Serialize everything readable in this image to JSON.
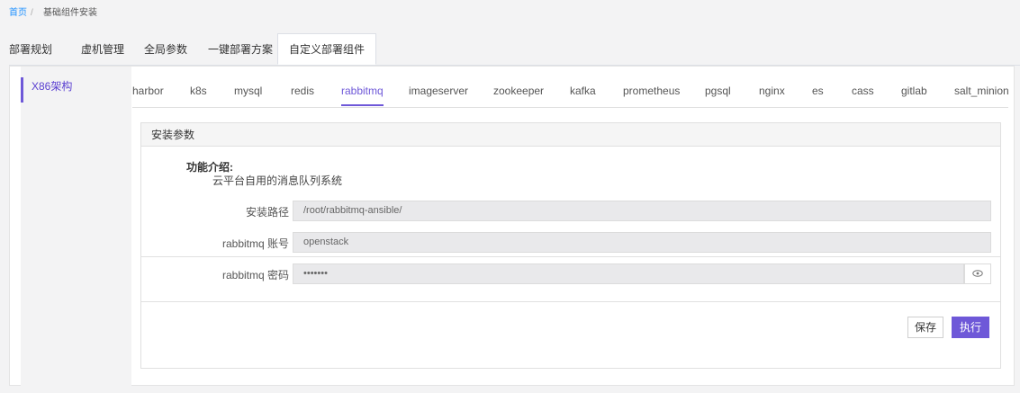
{
  "breadcrumb": {
    "home": "首页",
    "separator": "/",
    "current": "基础组件安装"
  },
  "top_tabs": [
    {
      "label": "部署规划"
    },
    {
      "label": "虚机管理"
    },
    {
      "label": "全局参数"
    },
    {
      "label": "一键部署方案"
    },
    {
      "label": "自定义部署组件",
      "active": true
    }
  ],
  "left_nav": {
    "items": [
      {
        "label": "X86架构",
        "active": true
      }
    ]
  },
  "sub_tabs": [
    {
      "label": "harbor"
    },
    {
      "label": "k8s"
    },
    {
      "label": "mysql"
    },
    {
      "label": "redis"
    },
    {
      "label": "rabbitmq",
      "active": true
    },
    {
      "label": "imageserver"
    },
    {
      "label": "zookeeper"
    },
    {
      "label": "kafka"
    },
    {
      "label": "prometheus"
    },
    {
      "label": "pgsql"
    },
    {
      "label": "nginx"
    },
    {
      "label": "es"
    },
    {
      "label": "cass"
    },
    {
      "label": "gitlab"
    },
    {
      "label": "salt_minion"
    }
  ],
  "card": {
    "title": "安装参数",
    "intro_title": "功能介绍:",
    "intro_text": "云平台自用的消息队列系统",
    "fields": [
      {
        "label": "安装路径",
        "value": "/root/rabbitmq-ansible/"
      },
      {
        "label": "rabbitmq 账号",
        "value": "openstack"
      },
      {
        "label": "rabbitmq 密码",
        "value": "•••••••"
      }
    ],
    "eye_icon": "eye-icon",
    "save_label": "保存",
    "exec_label": "执行"
  },
  "colors": {
    "accent": "#6e58d8",
    "link": "#1e90ff",
    "page_bg": "#f3f3f4"
  }
}
